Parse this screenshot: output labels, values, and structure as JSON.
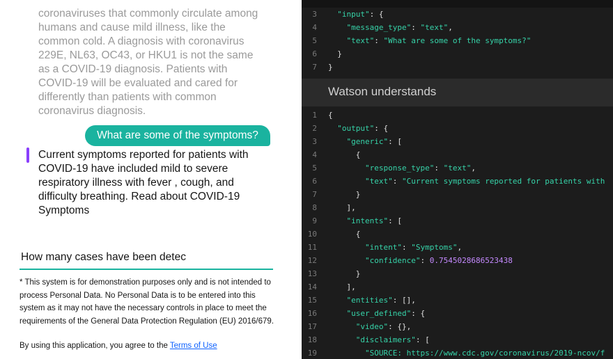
{
  "chat": {
    "previous_message": "coronaviruses that commonly circulate among humans and cause mild illness, like the common cold. A diagnosis with coronavirus 229E, NL63, OC43, or HKU1 is not the same as a COVID-19 diagnosis. Patients with COVID-19 will be evaluated and cared for differently than patients with common coronavirus diagnosis.",
    "user_message": "What are some of the symptoms?",
    "bot_message": "Current symptoms reported for patients with COVID-19 have included mild to severe respiratory illness with fever , cough, and difficulty breathing. Read about COVID-19 Symptoms",
    "input_value": "How many cases have been detec",
    "disclaimer": "* This system is for demonstration purposes only and is not intended to process Personal Data. No Personal Data is to be entered into this system as it may not have the necessary controls in place to meet the requirements of the General Data Protection Regulation (EU) 2016/679.",
    "agree_text": "By using this application, you agree to the ",
    "terms_link": "Terms of Use"
  },
  "panel": {
    "header": "Watson understands",
    "top_lines": [
      {
        "n": "3",
        "t": "  \"input\": {"
      },
      {
        "n": "4",
        "t": "    \"message_type\": \"text\","
      },
      {
        "n": "5",
        "t": "    \"text\": \"What are some of the symptoms?\""
      },
      {
        "n": "6",
        "t": "  }"
      },
      {
        "n": "7",
        "t": "}"
      }
    ],
    "bottom_lines": [
      {
        "n": "1",
        "t": "{"
      },
      {
        "n": "2",
        "t": "  \"output\": {"
      },
      {
        "n": "3",
        "t": "    \"generic\": ["
      },
      {
        "n": "4",
        "t": "      {"
      },
      {
        "n": "5",
        "t": "        \"response_type\": \"text\","
      },
      {
        "n": "6",
        "t": "        \"text\": \"Current symptoms reported for patients with"
      },
      {
        "n": "7",
        "t": "      }"
      },
      {
        "n": "8",
        "t": "    ],"
      },
      {
        "n": "9",
        "t": "    \"intents\": ["
      },
      {
        "n": "10",
        "t": "      {"
      },
      {
        "n": "11",
        "t": "        \"intent\": \"Symptoms\","
      },
      {
        "n": "12",
        "t": "        \"confidence\": 0.7545028686523438"
      },
      {
        "n": "13",
        "t": "      }"
      },
      {
        "n": "14",
        "t": "    ],"
      },
      {
        "n": "15",
        "t": "    \"entities\": [],"
      },
      {
        "n": "16",
        "t": "    \"user_defined\": {"
      },
      {
        "n": "17",
        "t": "      \"video\": {},"
      },
      {
        "n": "18",
        "t": "      \"disclaimers\": ["
      },
      {
        "n": "19",
        "t": "        \"SOURCE: https://www.cdc.gov/coronavirus/2019-ncov/f"
      }
    ]
  },
  "colors": {
    "accent": "#1ab39f",
    "bot_marker": "#8a3ffc",
    "link": "#0f62fe",
    "code_key": "#36d2a8",
    "code_number": "#c58aff",
    "code_bg": "#1c1c1c",
    "header_bg": "#2b2b2b"
  }
}
